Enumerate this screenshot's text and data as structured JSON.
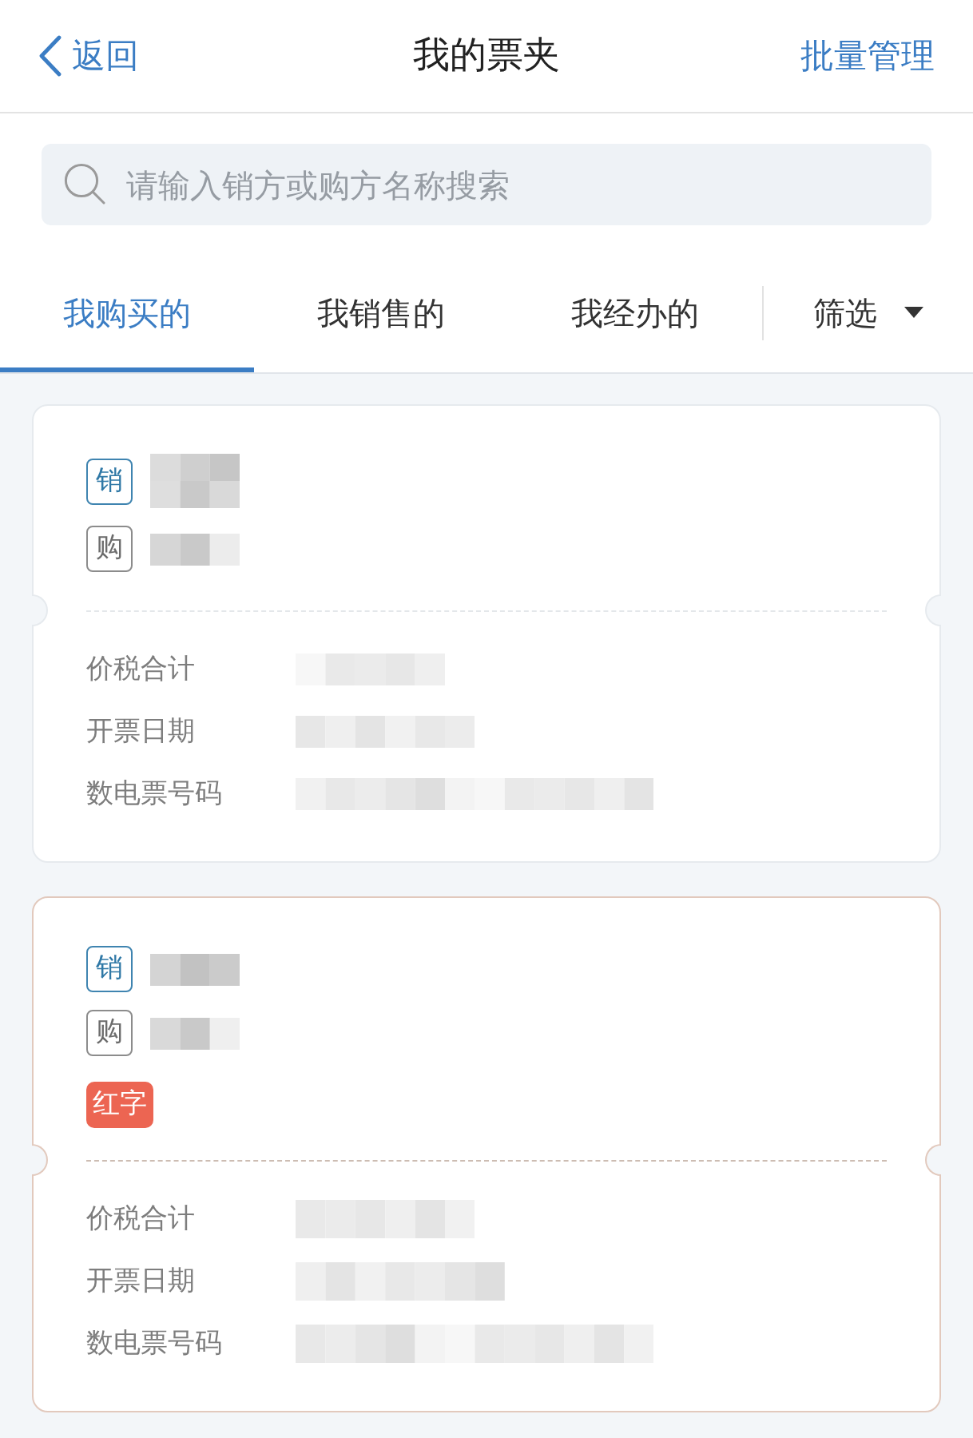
{
  "nav": {
    "back": "返回",
    "title": "我的票夹",
    "action": "批量管理"
  },
  "search": {
    "placeholder": "请输入销方或购方名称搜索"
  },
  "tabs": [
    {
      "label": "我购买的",
      "selected": true
    },
    {
      "label": "我销售的",
      "selected": false
    },
    {
      "label": "我经办的",
      "selected": false
    }
  ],
  "filter": {
    "label": "筛选"
  },
  "invoices": [
    {
      "red_letter": false,
      "parties": [
        {
          "kind": "seller",
          "tag": "销"
        },
        {
          "kind": "buyer",
          "tag": "购"
        }
      ],
      "fields": [
        {
          "label": "价税合计"
        },
        {
          "label": "开票日期"
        },
        {
          "label": "数电票号码"
        }
      ]
    },
    {
      "red_letter": true,
      "badge": "红字",
      "parties": [
        {
          "kind": "seller",
          "tag": "销"
        },
        {
          "kind": "buyer",
          "tag": "购"
        }
      ],
      "fields": [
        {
          "label": "价税合计"
        },
        {
          "label": "开票日期"
        },
        {
          "label": "数电票号码"
        }
      ]
    }
  ]
}
